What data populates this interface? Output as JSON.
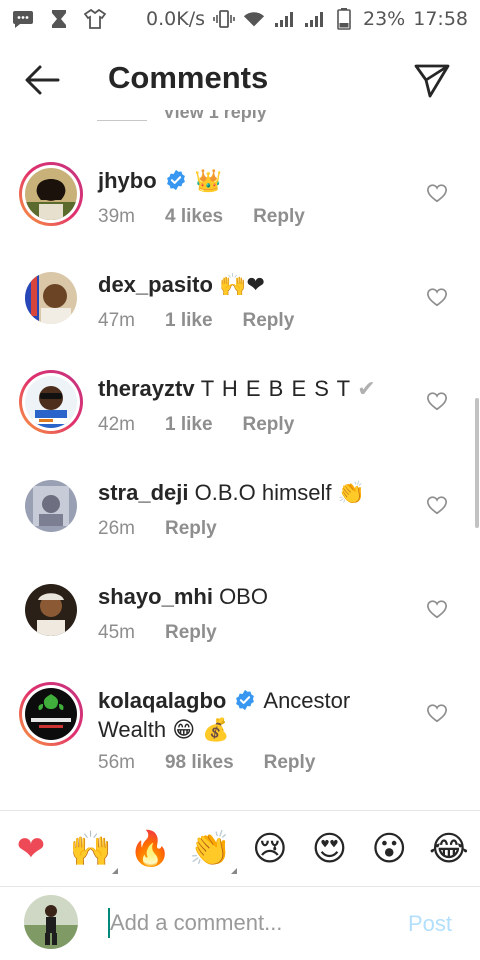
{
  "status_bar": {
    "speed": "0.0K/s",
    "battery": "23%",
    "time": "17:58",
    "icons": [
      "message-icon",
      "hourglass-icon",
      "shirt-icon",
      "vibrate-icon",
      "wifi-icon",
      "signal-icon",
      "signal-icon",
      "battery-icon"
    ]
  },
  "header": {
    "title": "Comments",
    "back_icon": "arrow-left-icon",
    "share_icon": "paper-plane-icon"
  },
  "view_replies": "View 1 reply",
  "comments": [
    {
      "username": "jhybo",
      "verified": true,
      "text": "",
      "emoji": "👑",
      "time": "39m",
      "likes": "4 likes",
      "reply": "Reply"
    },
    {
      "username": "dex_pasito",
      "verified": false,
      "text": "",
      "emoji": "🙌❤",
      "time": "47m",
      "likes": "1 like",
      "reply": "Reply"
    },
    {
      "username": "therayztv",
      "verified": false,
      "text": "T H E  B E S T",
      "emoji": "✔",
      "time": "42m",
      "likes": "1 like",
      "reply": "Reply"
    },
    {
      "username": "stra_deji",
      "verified": false,
      "text": "O.B.O himself",
      "emoji": "👏",
      "time": "26m",
      "likes": "",
      "reply": "Reply"
    },
    {
      "username": "shayo_mhi",
      "verified": false,
      "text": "OBO",
      "emoji": "",
      "time": "45m",
      "likes": "",
      "reply": "Reply"
    },
    {
      "username": "kolaqalagbo",
      "verified": true,
      "text": "Ancestor Wealth",
      "emoji": "😁 💰",
      "time": "56m",
      "likes": "98 likes",
      "reply": "Reply"
    }
  ],
  "reactions": [
    "❤",
    "🙌",
    "🔥",
    "👏",
    "😢",
    "😍",
    "😮",
    "😂"
  ],
  "composer": {
    "placeholder": "Add a comment...",
    "post_label": "Post"
  },
  "colors": {
    "verified_blue": "#3897f0",
    "story_ring_start": "#f9a13c",
    "story_ring_end": "#c13584",
    "post_disabled": "#b2dffc",
    "meta_grey": "#8e8e8e"
  }
}
